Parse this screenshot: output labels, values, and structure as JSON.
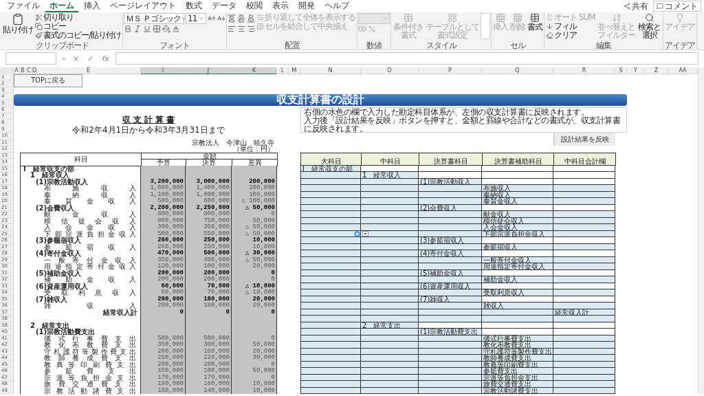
{
  "ribbon_tabs": [
    {
      "label": "ファイル",
      "selected": false
    },
    {
      "label": "ホーム",
      "selected": true
    },
    {
      "label": "挿入",
      "selected": false
    },
    {
      "label": "ページレイアウト",
      "selected": false
    },
    {
      "label": "数式",
      "selected": false
    },
    {
      "label": "データ",
      "selected": false
    },
    {
      "label": "校閲",
      "selected": false
    },
    {
      "label": "表示",
      "selected": false
    },
    {
      "label": "開発",
      "selected": false
    },
    {
      "label": "ヘルプ",
      "selected": false
    }
  ],
  "share_button": "共有",
  "comment_button": "コメント",
  "ribbon_groups": [
    {
      "kind": "clipboard",
      "label": "クリップボード",
      "paste": {
        "label": "貼り付け",
        "disabled": false
      },
      "cut": {
        "label": "切り取り",
        "disabled": false
      },
      "copy": {
        "label": "コピー",
        "disabled": false
      },
      "format_painter": {
        "label": "書式のコピー/貼り付け",
        "disabled": false
      }
    },
    {
      "kind": "font",
      "label": "フォント",
      "font_name": "ＭＳ Ｐゴシック",
      "font_size": "11"
    },
    {
      "kind": "alignment",
      "label": "配置",
      "wrap_text": {
        "label": "折り返して全体を表示する",
        "disabled": true
      },
      "merge": {
        "label": "セルを結合して中央揃え",
        "disabled": true
      }
    },
    {
      "kind": "number",
      "label": "数値"
    },
    {
      "kind": "styles",
      "label": "スタイル",
      "conditional_format": {
        "label": "条件付き書式",
        "disabled": true
      },
      "format_as_table": {
        "label": "テーブルとして書式設定",
        "disabled": true
      }
    },
    {
      "kind": "cells",
      "label": "セル",
      "insert": {
        "label": "挿入",
        "disabled": true
      },
      "delete": {
        "label": "削除",
        "disabled": true
      },
      "format": {
        "label": "書式",
        "disabled": false
      }
    },
    {
      "kind": "editing",
      "label": "編集",
      "autosum": {
        "label": "オート SUM",
        "disabled": true
      },
      "fill": {
        "label": "フィル",
        "disabled": false
      },
      "clear": {
        "label": "クリア",
        "disabled": false
      },
      "sort_filter": {
        "label": "並べ替えとフィルター",
        "disabled": true
      },
      "find_select": {
        "label": "検索と選択",
        "disabled": false
      }
    },
    {
      "kind": "ideas",
      "label": "アイデア",
      "ideas": {
        "label": "アイデア",
        "disabled": true
      }
    }
  ],
  "formula_bar": {
    "cancel": "×",
    "enter": "✓",
    "function": "fx"
  },
  "columns": [
    {
      "label": "A",
      "selected": false
    },
    {
      "label": "B",
      "selected": false
    },
    {
      "label": "C",
      "selected": false
    },
    {
      "label": "D",
      "selected": false
    },
    {
      "label": "E",
      "selected": false
    },
    {
      "label": "I",
      "selected": true
    },
    {
      "label": "J",
      "selected": true
    },
    {
      "label": "K",
      "selected": true
    },
    {
      "label": "L",
      "selected": false
    },
    {
      "label": "M",
      "selected": false
    },
    {
      "label": "N",
      "selected": false
    },
    {
      "label": "O",
      "selected": false
    },
    {
      "label": "P",
      "selected": false
    },
    {
      "label": "Q",
      "selected": false
    },
    {
      "label": "R",
      "selected": false
    },
    {
      "label": "S",
      "selected": false
    },
    {
      "label": "Y",
      "selected": false
    },
    {
      "label": "Z",
      "selected": false
    },
    {
      "label": "AA",
      "selected": false
    }
  ],
  "row_numbers": [
    "1",
    "2",
    "3",
    "4",
    "5",
    "6",
    "7",
    "8",
    "9",
    "10",
    "11",
    "12",
    "13",
    "14",
    "15",
    "16",
    "17",
    "18",
    "19",
    "20",
    "21",
    "22",
    "23",
    "24",
    "25",
    "26",
    "27",
    "28",
    "29",
    "30",
    "31",
    "32",
    "33",
    "34",
    "35",
    "36",
    "37",
    "38",
    "39",
    "40",
    "41",
    "42",
    "43",
    "44",
    "45",
    "46",
    "47",
    "48",
    "49"
  ],
  "top_button": "TOPに戻る",
  "banner": "収支計算書の設計",
  "statement": {
    "title": "収 支 計 算 書",
    "period": "令和2年4月1日から令和3年3月31日まで",
    "organization": "宗教法人　今津山　暁久寺",
    "unit": "（単位：円）",
    "header_subject": "科目",
    "header_amount": "金額",
    "amount_columns": [
      "予算",
      "決算",
      "差異"
    ],
    "rows": [
      {
        "kind": "section",
        "label": "Ⅰ　経常収支の部"
      },
      {
        "kind": "category",
        "label": "1　経常収入"
      },
      {
        "kind": "group",
        "label": "(1)宗教活動収入",
        "amounts": [
          "3,200,000",
          "3,000,000",
          "200,000"
        ]
      },
      {
        "kind": "item",
        "label": "布施収入",
        "amounts": [
          "1,600,000",
          "1,400,000",
          "200,000"
        ]
      },
      {
        "kind": "item",
        "label": "奉納収入",
        "amounts": [
          "1,100,000",
          "1,000,000",
          "100,000"
        ]
      },
      {
        "kind": "item",
        "label": "奉賛金収入",
        "amounts": [
          "500,000",
          "600,000",
          "△ 100,000"
        ]
      },
      {
        "kind": "group",
        "label": "(2)会費収入",
        "amounts": [
          "2,200,000",
          "2,250,000",
          "△ 50,000"
        ]
      },
      {
        "kind": "item",
        "label": "献金収入",
        "amounts": [
          "800,000",
          "800,000",
          "0"
        ]
      },
      {
        "kind": "item",
        "label": "檀信徒会収入",
        "amounts": [
          "800,000",
          "750,000",
          "50,000"
        ]
      },
      {
        "kind": "item",
        "label": "入会金収入",
        "amounts": [
          "300,000",
          "350,000",
          "△ 50,000"
        ]
      },
      {
        "kind": "item",
        "label": "下部宗派負担金収入",
        "amounts": [
          "500,000",
          "550,000",
          "△ 50,000"
        ]
      },
      {
        "kind": "group",
        "label": "(3)参籠宿収入",
        "amounts": [
          "260,000",
          "250,000",
          "10,000"
        ]
      },
      {
        "kind": "item",
        "label": "参籠宿収入",
        "amounts": [
          "260,000",
          "250,000",
          "10,000"
        ]
      },
      {
        "kind": "group",
        "label": "(4)寄付金収入",
        "amounts": [
          "470,000",
          "500,000",
          "△ 30,000"
        ]
      },
      {
        "kind": "item",
        "label": "一般寄付金収入",
        "amounts": [
          "350,000",
          "400,000",
          "△ 50,000"
        ]
      },
      {
        "kind": "item",
        "label": "用途指定寄付金収入",
        "amounts": [
          "120,000",
          "100,000",
          "20,000"
        ]
      },
      {
        "kind": "group",
        "label": "(5)補助金収入",
        "amounts": [
          "200,000",
          "200,000",
          "0"
        ]
      },
      {
        "kind": "item",
        "label": "補助金収入",
        "amounts": [
          "200,000",
          "200,000",
          "0"
        ]
      },
      {
        "kind": "group",
        "label": "(6)資産運用収入",
        "amounts": [
          "60,000",
          "70,000",
          "△ 10,000"
        ]
      },
      {
        "kind": "item",
        "label": "受取利息収入",
        "amounts": [
          "60,000",
          "70,000",
          "△ 10,000"
        ]
      },
      {
        "kind": "group",
        "label": "(7)雑収入",
        "amounts": [
          "200,000",
          "180,000",
          "20,000"
        ]
      },
      {
        "kind": "item",
        "label": "雑収入",
        "amounts": [
          "200,000",
          "180,000",
          "20,000"
        ]
      },
      {
        "kind": "total",
        "label": "経常収入計",
        "amounts": [
          "0",
          "0",
          "0"
        ]
      },
      {
        "kind": "blank"
      },
      {
        "kind": "category",
        "label": "2　経常支出"
      },
      {
        "kind": "group",
        "label": "(1)宗教活動費支出"
      },
      {
        "kind": "item",
        "label": "儀式行事費支出",
        "amounts": [
          "500,000",
          "500,000",
          "0"
        ]
      },
      {
        "kind": "item",
        "label": "教化布教費支出",
        "amounts": [
          "350,000",
          "300,000",
          "50,000"
        ]
      },
      {
        "kind": "item",
        "label": "守札護符等製作費支出",
        "amounts": [
          "200,000",
          "180,000",
          "20,000"
        ]
      },
      {
        "kind": "item",
        "label": "教師養成費支出",
        "amounts": [
          "250,000",
          "220,000",
          "30,000"
        ]
      },
      {
        "kind": "item",
        "label": "教典等印刷費支出",
        "amounts": [
          "200,000",
          "200,000",
          "0"
        ]
      },
      {
        "kind": "item",
        "label": "参籠費支出",
        "amounts": [
          "150,000",
          "100,000",
          "50,000"
        ]
      },
      {
        "kind": "item",
        "label": "宗派等負担金支出",
        "amounts": [
          "170,000",
          "170,000",
          "0"
        ]
      },
      {
        "kind": "item",
        "label": "旅費交通費支出",
        "amounts": [
          "190,000",
          "180,000",
          "10,000"
        ]
      },
      {
        "kind": "item",
        "label": "宗教活動諸費支出",
        "amounts": [
          "150,000",
          "140,000",
          "10,000"
        ]
      }
    ]
  },
  "note": [
    "右側の水色の欄で入力した勘定科目体系が、左側の収支計算書に反映されます。",
    "入力後「設計結果を反映」ボタンを押すと、金額と罫線や合計などの書式が、収支計算書に反映されます。"
  ],
  "apply_button": "設計結果を反映",
  "design_table": {
    "columns": [
      "大科目",
      "中科目",
      "決算書科目",
      "決算書補助科目",
      "中科目合計欄"
    ],
    "rows": [
      {
        "kind": "entry",
        "major": "Ⅰ　経常収支の部",
        "dropdown": false
      },
      {
        "kind": "entry",
        "middle": "1　経常収入",
        "dropdown": false
      },
      {
        "kind": "entry",
        "account": "(1)宗教活動収入",
        "dropdown": false
      },
      {
        "kind": "entry",
        "sub_account": "布施収入",
        "dropdown": false
      },
      {
        "kind": "entry",
        "sub_account": "奉納収入",
        "dropdown": false
      },
      {
        "kind": "entry",
        "sub_account": "奉賛金収入",
        "dropdown": false
      },
      {
        "kind": "entry",
        "account": "(2)会費収入",
        "dropdown": false
      },
      {
        "kind": "entry",
        "sub_account": "献金収入",
        "dropdown": false
      },
      {
        "kind": "entry",
        "sub_account": "檀信徒会収入",
        "dropdown": false
      },
      {
        "kind": "entry",
        "sub_account": "入会金収入",
        "dropdown": false
      },
      {
        "kind": "entry",
        "sub_account": "下部宗派負担金収入",
        "dropdown": true
      },
      {
        "kind": "entry",
        "account": "(3)参籠宿収入",
        "dropdown": false
      },
      {
        "kind": "entry",
        "sub_account": "参籠宿収入",
        "dropdown": false
      },
      {
        "kind": "entry",
        "account": "(4)寄付金収入",
        "dropdown": false
      },
      {
        "kind": "entry",
        "sub_account": "一般寄付金収入",
        "dropdown": false
      },
      {
        "kind": "entry",
        "sub_account": "用途指定寄付金収入",
        "dropdown": false
      },
      {
        "kind": "entry",
        "account": "(5)補助金収入",
        "dropdown": false
      },
      {
        "kind": "entry",
        "sub_account": "補助金収入",
        "dropdown": false
      },
      {
        "kind": "entry",
        "account": "(6)資産運用収入",
        "dropdown": false
      },
      {
        "kind": "entry",
        "sub_account": "受取利息収入",
        "dropdown": false
      },
      {
        "kind": "entry",
        "account": "(7)雑収入",
        "dropdown": false
      },
      {
        "kind": "entry",
        "sub_account": "雑収入",
        "dropdown": false
      },
      {
        "kind": "entry",
        "subtotal": "経常収入計",
        "dropdown": false
      },
      {
        "kind": "blank",
        "dropdown": false
      },
      {
        "kind": "entry",
        "middle": "2　経常支出",
        "dropdown": false
      },
      {
        "kind": "entry",
        "account": "(1)宗教活動費支出",
        "dropdown": false
      },
      {
        "kind": "entry",
        "sub_account": "儀式行事費支出",
        "dropdown": false
      },
      {
        "kind": "entry",
        "sub_account": "教化布教費支出",
        "dropdown": false
      },
      {
        "kind": "entry",
        "sub_account": "守札護符等製作費支出",
        "dropdown": false
      },
      {
        "kind": "entry",
        "sub_account": "教師養成費支出",
        "dropdown": false
      },
      {
        "kind": "entry",
        "sub_account": "教典等印刷費支出",
        "dropdown": false
      },
      {
        "kind": "entry",
        "sub_account": "参籠費支出",
        "dropdown": false
      },
      {
        "kind": "entry",
        "sub_account": "宗派等負担金支出",
        "dropdown": false
      },
      {
        "kind": "entry",
        "sub_account": "旅費交通費支出",
        "dropdown": false
      },
      {
        "kind": "entry",
        "sub_account": "宗教活動諸費支出",
        "dropdown": false
      }
    ]
  }
}
